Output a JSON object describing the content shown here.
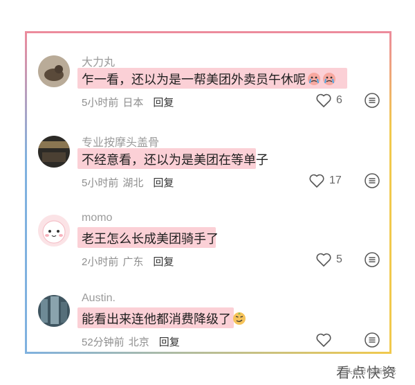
{
  "comments": [
    {
      "username": "大力丸",
      "text": "乍一看，还以为是一帮美团外卖员午休呢",
      "time": "5小时前",
      "location": "日本",
      "reply": "回复",
      "likes": "6",
      "emoji": "crying-face-emoji"
    },
    {
      "username": "专业按摩头盖骨",
      "text": "不经意看，还以为是美团在等单子",
      "time": "5小时前",
      "location": "湖北",
      "reply": "回复",
      "likes": "17"
    },
    {
      "username": "momo",
      "text": "老王怎么长成美团骑手了",
      "time": "2小时前",
      "location": "广东",
      "reply": "回复",
      "likes": "5"
    },
    {
      "username": "Austin.",
      "text": "能看出来连他都消费降级了",
      "time": "52分钟前",
      "location": "北京",
      "reply": "回复",
      "likes": "",
      "emoji": "smirk-face-emoji"
    }
  ],
  "watermark": {
    "main": "看点快资",
    "sub": "头条号 @新知老"
  },
  "colors": {
    "frame_top": "#ec8b9c",
    "frame_left": "#7fb1df",
    "frame_right": "#f1c94c",
    "highlight": "#fbd0d6"
  }
}
